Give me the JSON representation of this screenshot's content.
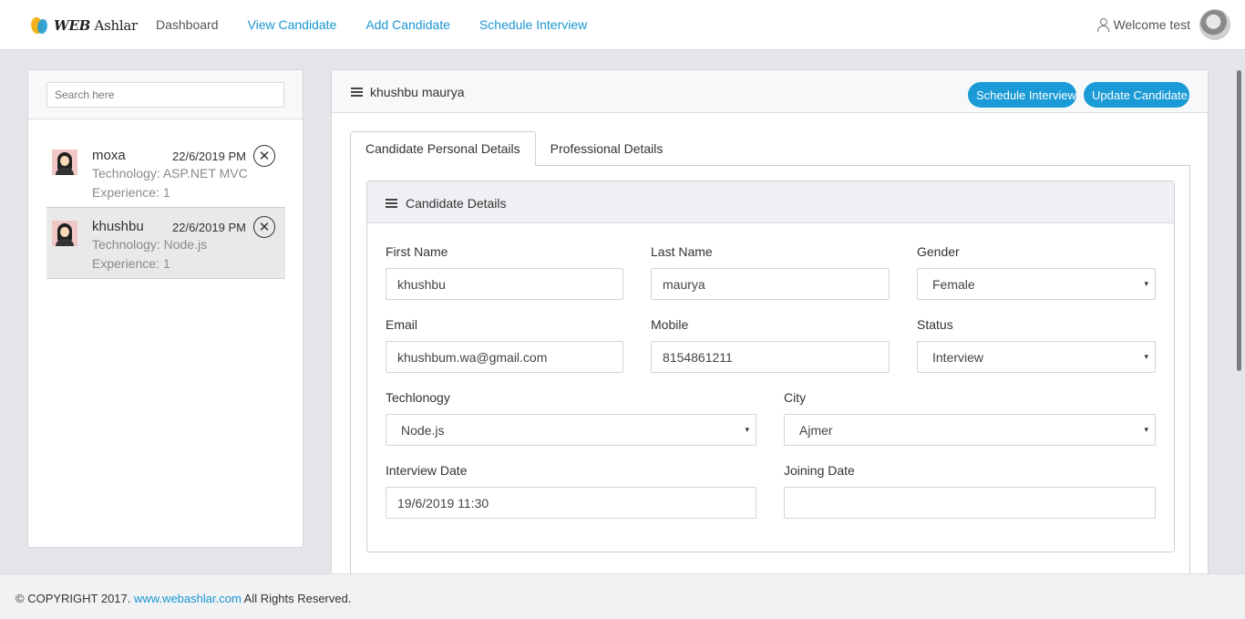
{
  "brand": {
    "web": "WEB",
    "name": "Ashlar"
  },
  "nav": [
    {
      "label": "Dashboard"
    },
    {
      "label": "View Candidate"
    },
    {
      "label": "Add Candidate"
    },
    {
      "label": "Schedule Interview"
    }
  ],
  "user": {
    "welcome": "Welcome test"
  },
  "sidebar": {
    "search_placeholder": "Search here",
    "candidates": [
      {
        "name": "moxa",
        "date": "22/6/2019 PM",
        "technology": "Technology: ASP.NET MVC",
        "experience": "Experience: 1",
        "active": false
      },
      {
        "name": "khushbu",
        "date": "22/6/2019 PM",
        "technology": "Technology: Node.js",
        "experience": "Experience: 1",
        "active": true
      }
    ]
  },
  "main": {
    "title": "khushbu maurya",
    "buttons": {
      "schedule": "Schedule Interview",
      "update": "Update Candidate"
    },
    "tabs": [
      {
        "label": "Candidate Personal Details",
        "active": true
      },
      {
        "label": "Professional Details",
        "active": false
      }
    ],
    "details_title": "Candidate Details",
    "fields": {
      "first_name": {
        "label": "First Name",
        "value": "khushbu"
      },
      "last_name": {
        "label": "Last Name",
        "value": "maurya"
      },
      "gender": {
        "label": "Gender",
        "value": "Female"
      },
      "email": {
        "label": "Email",
        "value": "khushbum.wa@gmail.com"
      },
      "mobile": {
        "label": "Mobile",
        "value": "8154861211"
      },
      "status": {
        "label": "Status",
        "value": "Interview"
      },
      "technology": {
        "label": "Techlonogy",
        "value": "Node.js"
      },
      "city": {
        "label": "City",
        "value": "Ajmer"
      },
      "interview_date": {
        "label": "Interview Date",
        "value": "19/6/2019 11:30"
      },
      "joining_date": {
        "label": "Joining Date",
        "value": ""
      }
    }
  },
  "footer": {
    "prefix": "© COPYRIGHT 2017. ",
    "link": "www.webashlar.com",
    "suffix": " All Rights Reserved."
  },
  "icons": {
    "caret": "▾",
    "close": "✕"
  },
  "colors": {
    "accent": "#1a9ad6",
    "background": "#e4e5e8"
  }
}
